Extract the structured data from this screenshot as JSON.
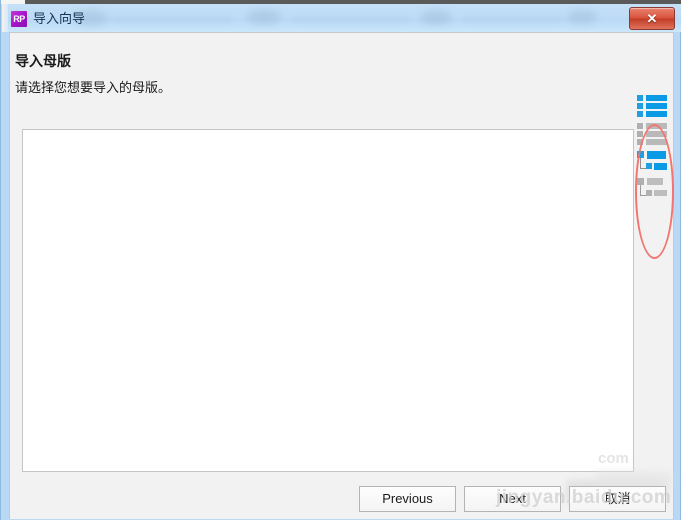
{
  "window": {
    "title": "导入向导",
    "app_icon_label": "RP",
    "close_label": "✕",
    "accent_blue": "#b8d8f5",
    "body_bg": "#f2f2f2",
    "close_red": "#d9533c",
    "icon_purple": "#a715c9"
  },
  "header": {
    "heading": "导入母版",
    "subheading": "请选择您想要导入的母版。"
  },
  "list_panel": {
    "items": [],
    "empty": true
  },
  "view_tools": {
    "annotation_color": "#f4756f",
    "items": [
      {
        "name": "list-view-large-active",
        "state": "active",
        "color": "#0b9ae5"
      },
      {
        "name": "list-view-large-inactive",
        "state": "inactive",
        "color": "#b9b9b9"
      },
      {
        "name": "tree-view-active",
        "state": "active",
        "color": "#0b9ae5"
      },
      {
        "name": "tree-view-inactive",
        "state": "inactive",
        "color": "#b9b9b9"
      }
    ]
  },
  "footer": {
    "previous_label": "Previous",
    "next_label": "Next",
    "cancel_label": "取消"
  },
  "watermark": {
    "text": "jingyan.baidu.com",
    "ghost_text": "com"
  }
}
